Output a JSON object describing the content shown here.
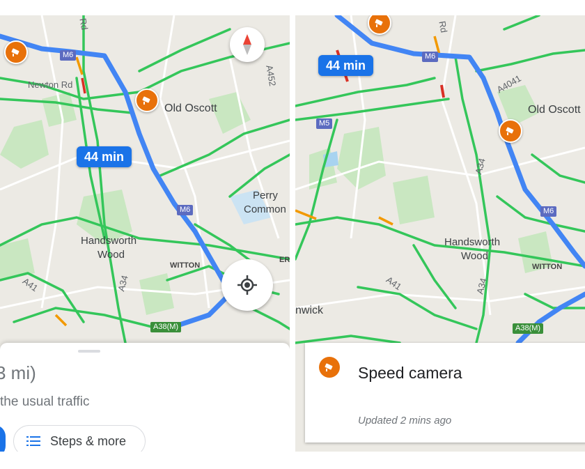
{
  "left_panel": {
    "eta": "44 min",
    "places": {
      "newton_rd": "Newton Rd",
      "old_oscott": "Old Oscott",
      "perry": "Perry",
      "common": "Common",
      "handsworth": "Handsworth",
      "wood": "Wood",
      "witton": "WITTON",
      "er": "ER",
      "rd_top": "Rd",
      "a452": "A452",
      "a41": "A41",
      "a34": "A34",
      "m6_top": "M6",
      "m6_mid": "M6",
      "a38m": "A38(M)"
    },
    "sheet": {
      "distance": "3 mi)",
      "traffic_note": "the usual traffic",
      "steps_button": "Steps & more"
    },
    "icons": [
      "speed-camera-icon",
      "compass-icon",
      "my-location-icon",
      "list-icon"
    ]
  },
  "right_panel": {
    "eta": "44 min",
    "places": {
      "old_oscott": "Old Oscott",
      "handsworth": "Handsworth",
      "wood": "Wood",
      "witton": "WITTON",
      "nwick": "nwick",
      "rd_top": "Rd",
      "a4041": "A4041",
      "a41": "A41",
      "a34": "A34",
      "a34b": "A34",
      "m6_top": "M6",
      "m6_mid": "M6",
      "m5": "M5",
      "a38m": "A38(M)"
    },
    "card": {
      "title": "Speed camera",
      "updated": "Updated 2 mins ago"
    }
  },
  "colors": {
    "route": "#4285f4",
    "eta_bubble": "#1a73e8",
    "camera": "#e8710a",
    "traffic_green": "#34c65a",
    "map_bg": "#eceae4",
    "park": "#c9e7c1"
  }
}
